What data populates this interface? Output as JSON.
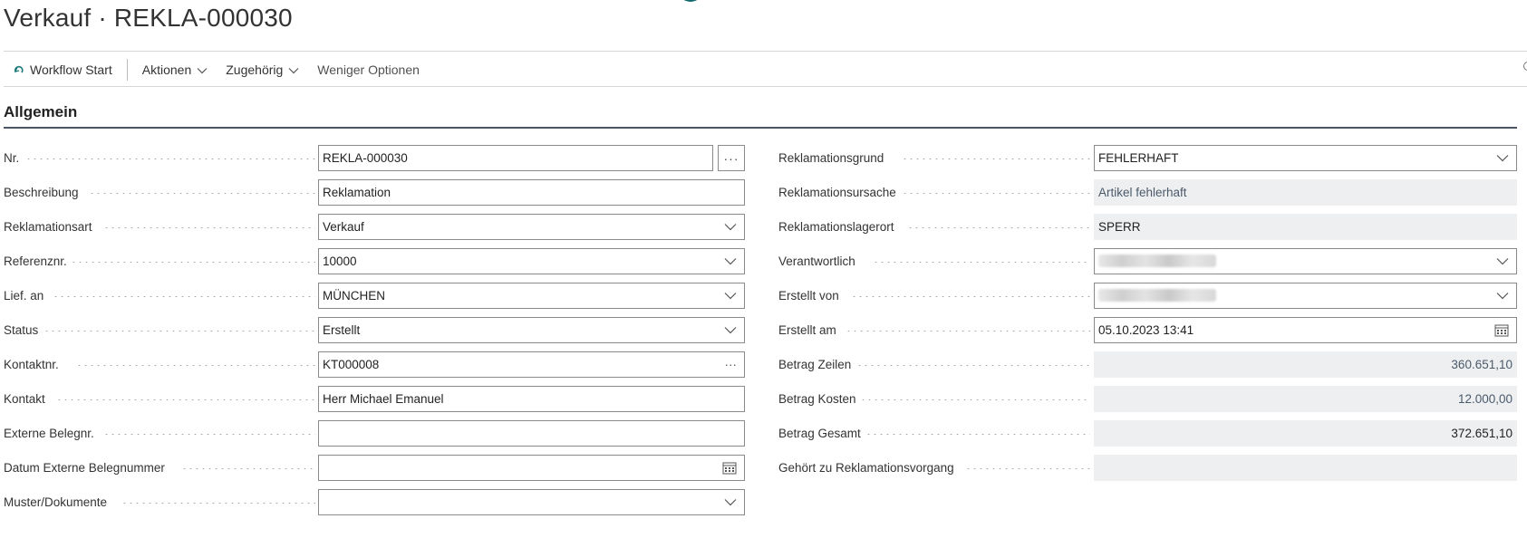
{
  "page": {
    "title": "Verkauf · REKLA-000030"
  },
  "actions": {
    "workflow_start": "Workflow Start",
    "aktionen": "Aktionen",
    "zugehoerig": "Zugehörig",
    "weniger_optionen": "Weniger Optionen"
  },
  "section": {
    "title": "Allgemein"
  },
  "left": [
    {
      "label": "Nr.",
      "value": "REKLA-000030"
    },
    {
      "label": "Beschreibung",
      "value": "Reklamation"
    },
    {
      "label": "Reklamationsart",
      "value": "Verkauf"
    },
    {
      "label": "Referenznr.",
      "value": "10000"
    },
    {
      "label": "Lief. an",
      "value": "MÜNCHEN"
    },
    {
      "label": "Status",
      "value": "Erstellt"
    },
    {
      "label": "Kontaktnr.",
      "value": "KT000008"
    },
    {
      "label": "Kontakt",
      "value": "Herr Michael Emanuel"
    },
    {
      "label": "Externe Belegnr.",
      "value": ""
    },
    {
      "label": "Datum Externe Belegnummer",
      "value": ""
    },
    {
      "label": "Muster/Dokumente",
      "value": ""
    }
  ],
  "right": [
    {
      "label": "Reklamationsgrund",
      "value": "FEHLERHAFT"
    },
    {
      "label": "Reklamationsursache",
      "value": "Artikel fehlerhaft"
    },
    {
      "label": "Reklamationslagerort",
      "value": "SPERR"
    },
    {
      "label": "Verantwortlich",
      "value": ""
    },
    {
      "label": "Erstellt von",
      "value": ""
    },
    {
      "label": "Erstellt am",
      "value": "05.10.2023 13:41"
    },
    {
      "label": "Betrag Zeilen",
      "value": "360.651,10"
    },
    {
      "label": "Betrag Kosten",
      "value": "12.000,00"
    },
    {
      "label": "Betrag Gesamt",
      "value": "372.651,10"
    },
    {
      "label": "Gehört zu Reklamationsvorgang",
      "value": ""
    }
  ],
  "icons": {
    "workflow": "workflow-icon",
    "dropdown": "chevron-down-icon",
    "calendar": "calendar-icon",
    "more": "ellipsis-icon"
  },
  "colors": {
    "section_rule": "#4b5563",
    "readonly_bg": "#eeeff1",
    "workflow_icon": "#1a7a7a"
  }
}
